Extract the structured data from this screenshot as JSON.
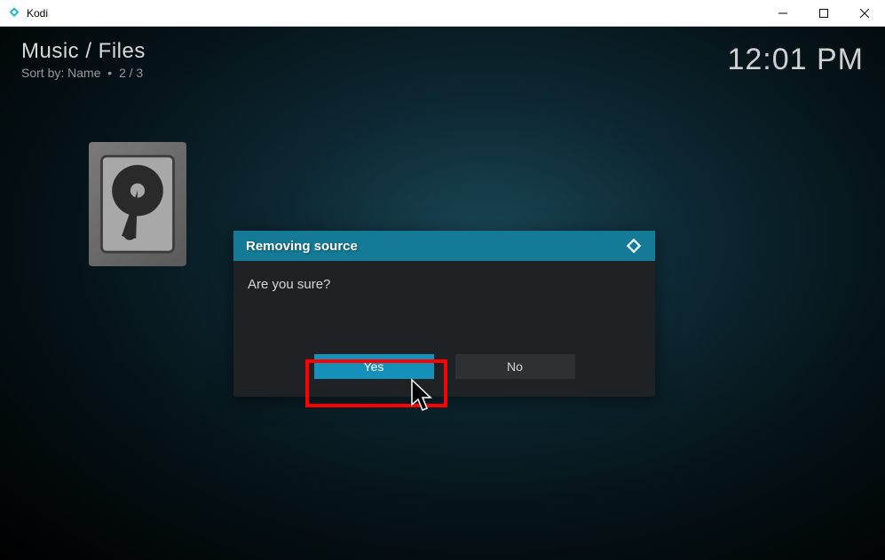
{
  "window": {
    "title": "Kodi"
  },
  "header": {
    "breadcrumb": "Music / Files",
    "sort_label": "Sort by: Name",
    "page_indicator": "2 / 3"
  },
  "clock": "12:01 PM",
  "dialog": {
    "title": "Removing source",
    "message": "Are you sure?",
    "yes_label": "Yes",
    "no_label": "No"
  }
}
